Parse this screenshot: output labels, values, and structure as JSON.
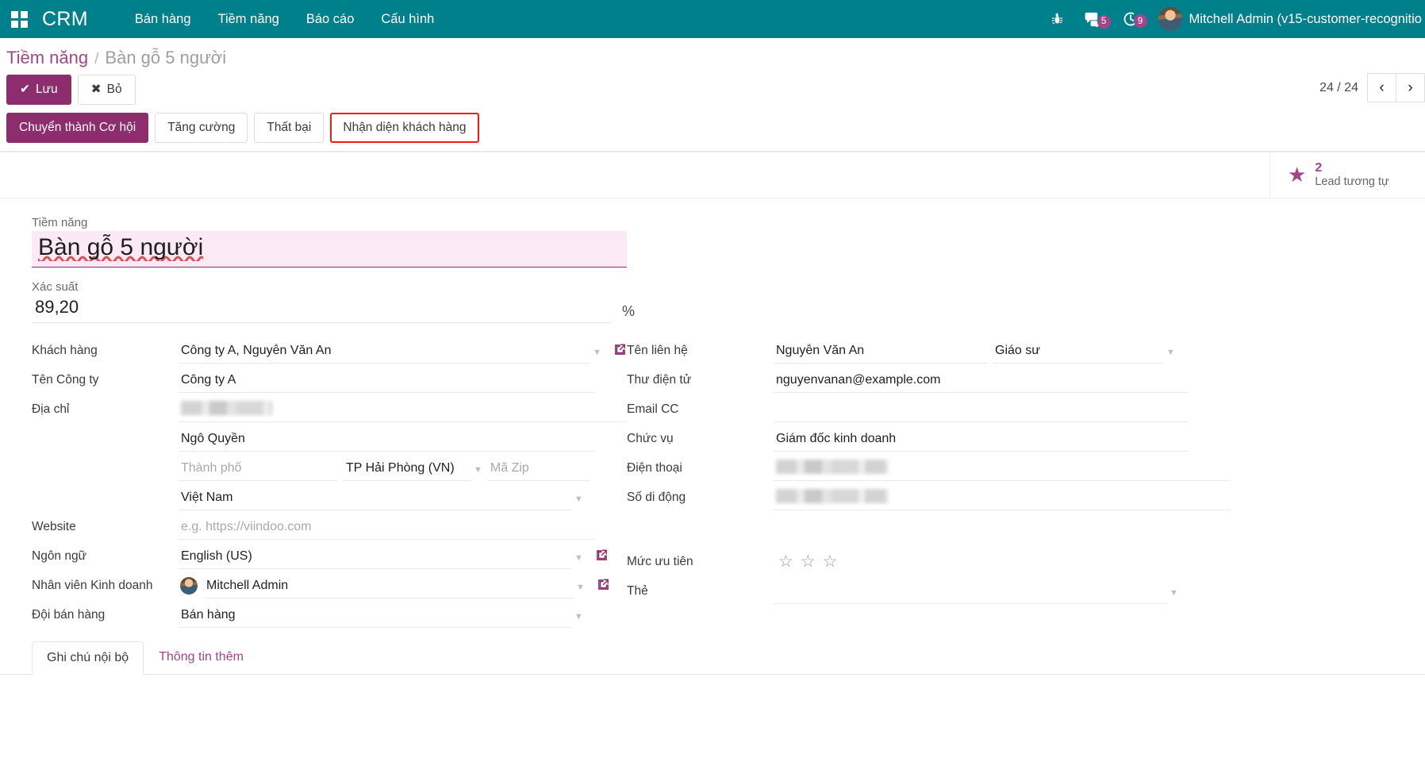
{
  "navbar": {
    "brand": "CRM",
    "apps_icon": "apps-grid-icon",
    "menu": [
      {
        "label": "Bán hàng"
      },
      {
        "label": "Tiềm năng"
      },
      {
        "label": "Báo cáo"
      },
      {
        "label": "Cấu hình"
      }
    ],
    "debug_icon": "bug-icon",
    "messages": {
      "icon": "chat-bubble-icon",
      "badge": "5"
    },
    "activities": {
      "icon": "clock-icon",
      "badge": "9"
    },
    "user": {
      "name": "Mitchell Admin (v15-customer-recognitio",
      "avatar": "user-avatar"
    }
  },
  "control_panel": {
    "breadcrumb_root": "Tiềm năng",
    "breadcrumb_sep": "/",
    "breadcrumb_current": "Bàn gỗ 5 người",
    "save_label": "Lưu",
    "save_icon": "check-icon",
    "discard_label": "Bỏ",
    "discard_icon": "times-icon",
    "pager_text": "24 / 24",
    "pager_prev_icon": "chevron-left-icon",
    "pager_next_icon": "chevron-right-icon"
  },
  "statusbar_buttons": [
    {
      "label": "Chuyển thành Cơ hội",
      "style": "primary"
    },
    {
      "label": "Tăng cường",
      "style": "default"
    },
    {
      "label": "Thất bại",
      "style": "default"
    },
    {
      "label": "Nhận diện khách hàng",
      "style": "highlighted"
    }
  ],
  "stat_button": {
    "icon": "star-icon",
    "value": "2",
    "label": "Lead tương tự"
  },
  "form": {
    "title_label": "Tiềm năng",
    "title_value": "Bàn gỗ 5 người",
    "probability_label": "Xác suất",
    "probability_value": "89,20",
    "probability_suffix": "%",
    "left": {
      "customer_label": "Khách hàng",
      "customer_value": "Công ty A, Nguyễn Văn An",
      "company_label": "Tên Công ty",
      "company_value": "Công ty A",
      "address_label": "Địa chỉ",
      "street_value": "",
      "street2_value": "Ngô Quyền",
      "city_placeholder": "Thành phố",
      "city_value": "",
      "state_value": "TP Hải Phòng (VN)",
      "zip_placeholder": "Mã Zip",
      "zip_value": "",
      "country_value": "Việt Nam",
      "website_label": "Website",
      "website_placeholder": "e.g. https://viindoo.com",
      "website_value": "",
      "language_label": "Ngôn ngữ",
      "language_value": "English (US)",
      "salesperson_label": "Nhân viên Kinh doanh",
      "salesperson_value": "Mitchell Admin",
      "salesteam_label": "Đội bán hàng",
      "salesteam_value": "Bán hàng"
    },
    "right": {
      "contact_label": "Tên liên hệ",
      "contact_value": "Nguyễn Văn An",
      "contact_title_value": "Giáo sư",
      "email_label": "Thư điện tử",
      "email_value": "nguyenvanan@example.com",
      "email_cc_label": "Email CC",
      "email_cc_value": "",
      "job_label": "Chức vụ",
      "job_value": "Giám đốc kinh doanh",
      "phone_label": "Điện thoại",
      "mobile_label": "Số di động",
      "priority_label": "Mức ưu tiên",
      "tags_label": "Thẻ",
      "tags_value": ""
    }
  },
  "notebook": {
    "tabs": [
      {
        "label": "Ghi chú nội bộ",
        "active": true
      },
      {
        "label": "Thông tin thêm",
        "active": false
      }
    ]
  },
  "colors": {
    "navbar_bg": "#00808a",
    "accent": "#8e2d6e",
    "badge": "#a24689",
    "highlight_outline": "#f01c10",
    "title_field_bg": "#fbeaf6"
  }
}
